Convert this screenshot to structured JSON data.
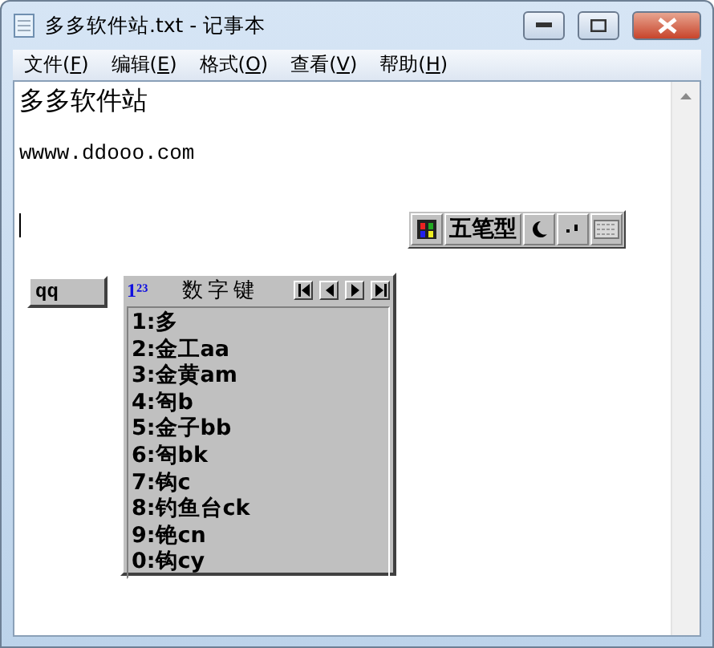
{
  "window": {
    "title": "多多软件站.txt - 记事本"
  },
  "menu": [
    {
      "before": "文件(",
      "mnemonic": "F",
      "after": ")"
    },
    {
      "before": "编辑(",
      "mnemonic": "E",
      "after": ")"
    },
    {
      "before": "格式(",
      "mnemonic": "O",
      "after": ")"
    },
    {
      "before": "查看(",
      "mnemonic": "V",
      "after": ")"
    },
    {
      "before": "帮助(",
      "mnemonic": "H",
      "after": ")"
    }
  ],
  "document": [
    {
      "kind": "heading",
      "text": "多多软件站"
    },
    {
      "kind": "body",
      "text": "wwww.ddooo.com"
    }
  ],
  "ime_toolbar": {
    "mode": "五笔型"
  },
  "composition": {
    "input": "qq"
  },
  "candidates": {
    "logo": "1²³",
    "title": "数字键",
    "items": [
      "1:多",
      "2:金工aa",
      "3:金黄am",
      "4:匌b",
      "5:金子bb",
      "6:匌bk",
      "7:钩c",
      "8:钓鱼台ck",
      "9:铯cn",
      "0:钩cy"
    ]
  }
}
